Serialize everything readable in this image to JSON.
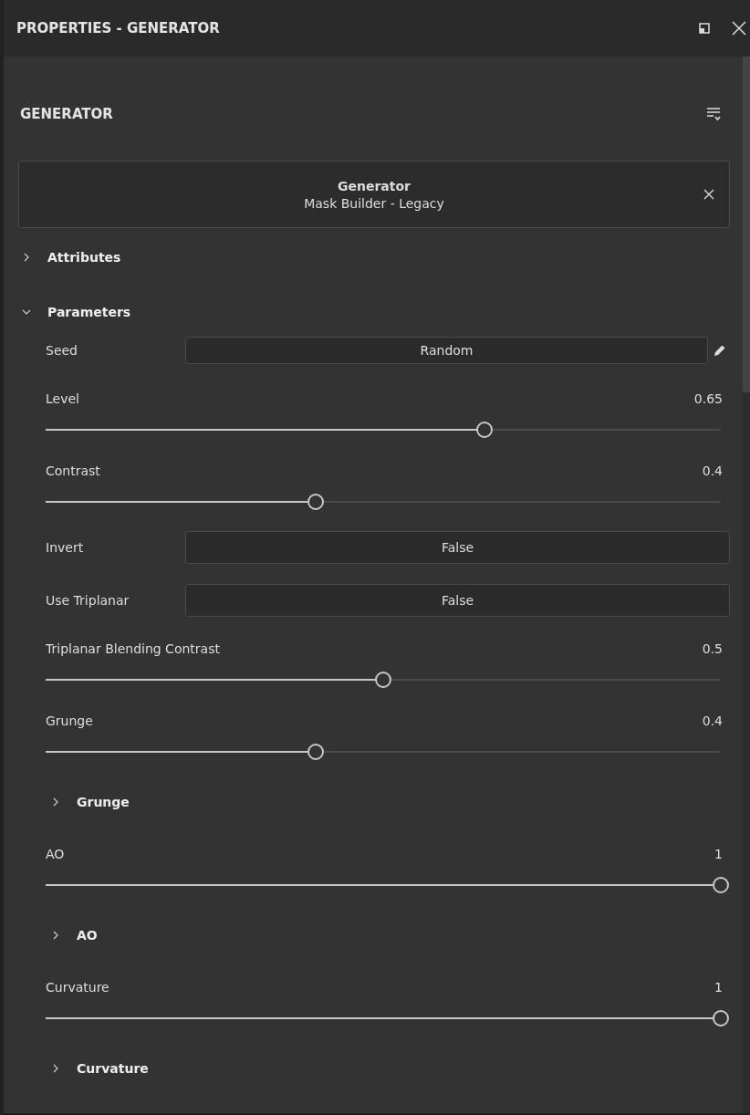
{
  "window": {
    "title": "PROPERTIES - GENERATOR"
  },
  "panel": {
    "heading": "GENERATOR"
  },
  "generator_card": {
    "title": "Generator",
    "subtitle": "Mask Builder - Legacy"
  },
  "sections": [
    {
      "label": "Attributes",
      "expanded": false
    },
    {
      "label": "Parameters",
      "expanded": true,
      "items": [
        {
          "kind": "field",
          "label": "Seed",
          "value": "Random",
          "editable": true
        },
        {
          "kind": "slider",
          "label": "Level",
          "reading": "0.65",
          "level": 0.65
        },
        {
          "kind": "slider",
          "label": "Contrast",
          "reading": "0.4",
          "level": 0.4
        },
        {
          "kind": "field",
          "label": "Invert",
          "value": "False"
        },
        {
          "kind": "field",
          "label": "Use Triplanar",
          "value": "False"
        },
        {
          "kind": "slider",
          "label": "Triplanar Blending Contrast",
          "reading": "0.5",
          "level": 0.5
        },
        {
          "kind": "slider",
          "label": "Grunge",
          "reading": "0.4",
          "level": 0.4
        },
        {
          "kind": "group",
          "label": "Grunge",
          "expanded": false
        },
        {
          "kind": "slider",
          "label": "AO",
          "reading": "1",
          "level": 1
        },
        {
          "kind": "group",
          "label": "AO",
          "expanded": false
        },
        {
          "kind": "slider",
          "label": "Curvature",
          "reading": "1",
          "level": 1
        },
        {
          "kind": "group",
          "label": "Curvature",
          "expanded": false
        }
      ]
    }
  ]
}
